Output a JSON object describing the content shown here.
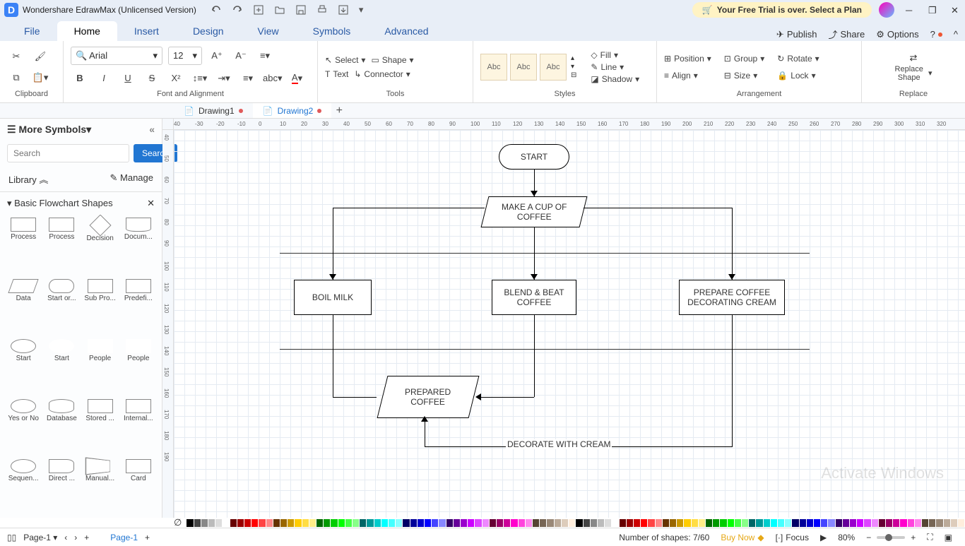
{
  "app": {
    "title": "Wondershare EdrawMax (Unlicensed Version)",
    "trial_text": "Your Free Trial is over. Select a Plan"
  },
  "menu": {
    "tabs": [
      "File",
      "Home",
      "Insert",
      "Design",
      "View",
      "Symbols",
      "Advanced"
    ],
    "active": "Home",
    "right": {
      "publish": "Publish",
      "share": "Share",
      "options": "Options"
    }
  },
  "ribbon": {
    "clipboard": "Clipboard",
    "font_align": "Font and Alignment",
    "tools": "Tools",
    "styles": "Styles",
    "arrangement": "Arrangement",
    "replace": "Replace",
    "font_name": "Arial",
    "font_size": "12",
    "select": "Select",
    "shape": "Shape",
    "text": "Text",
    "connector": "Connector",
    "abc": "Abc",
    "fill": "Fill",
    "line": "Line",
    "shadow": "Shadow",
    "position": "Position",
    "align": "Align",
    "group": "Group",
    "size": "Size",
    "rotate": "Rotate",
    "lock": "Lock",
    "replace_shape": "Replace\nShape"
  },
  "docs": {
    "tabs": [
      {
        "name": "Drawing1",
        "modified": true,
        "active": false
      },
      {
        "name": "Drawing2",
        "modified": true,
        "active": true
      }
    ]
  },
  "side": {
    "more_symbols": "More Symbols",
    "search_placeholder": "Search",
    "search_btn": "Search",
    "library": "Library",
    "manage": "Manage",
    "section": "Basic Flowchart Shapes",
    "shapes": [
      "Process",
      "Process",
      "Decision",
      "Docum...",
      "Data",
      "Start or...",
      "Sub Pro...",
      "Predefi...",
      "Start",
      "Start",
      "People",
      "People",
      "Yes or No",
      "Database",
      "Stored ...",
      "Internal...",
      "Sequen...",
      "Direct ...",
      "Manual...",
      "Card"
    ]
  },
  "ruler_h": [
    "40",
    "-30",
    "-20",
    "-10",
    "0",
    "10",
    "20",
    "30",
    "40",
    "50",
    "60",
    "70",
    "80",
    "90",
    "100",
    "110",
    "120",
    "130",
    "140",
    "150",
    "160",
    "170",
    "180",
    "190",
    "200",
    "210",
    "220",
    "230",
    "240",
    "250",
    "260",
    "270",
    "280",
    "290",
    "300",
    "310",
    "320"
  ],
  "ruler_v": [
    "40",
    "50",
    "60",
    "70",
    "80",
    "90",
    "100",
    "110",
    "120",
    "130",
    "140",
    "150",
    "160",
    "170",
    "180",
    "190"
  ],
  "flowchart": {
    "start": "START",
    "makecup": "MAKE A CUP OF\nCOFFEE",
    "boil": "BOIL MILK",
    "blend": "BLEND & BEAT\nCOFFEE",
    "prepare_cream": "PREPARE COFFEE\nDECORATING CREAM",
    "prepared": "PREPARED\nCOFFEE",
    "decorate": "DECORATE WITH CREAM"
  },
  "status": {
    "page_label": "Page-1",
    "page_tab": "Page-1",
    "shapes_count": "Number of shapes: 7/60",
    "buy_now": "Buy Now",
    "focus": "Focus",
    "zoom": "80%"
  },
  "watermark": "Activate Windows"
}
